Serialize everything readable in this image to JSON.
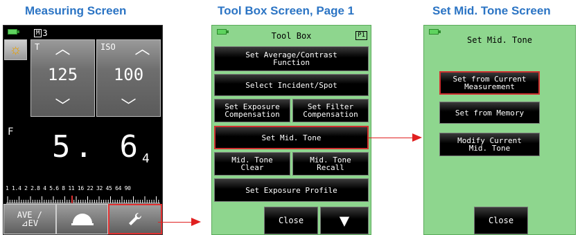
{
  "captions": {
    "measuring": "Measuring Screen",
    "toolbox": "Tool Box Screen, Page 1",
    "midtone": "Set Mid. Tone Screen"
  },
  "measuring": {
    "mode_prefix": "M",
    "mode_number": "3",
    "t_label": "T",
    "t_value": "125",
    "iso_label": "ISO",
    "iso_value": "100",
    "f_label": "F",
    "f_value_main": "5. 6",
    "f_value_sub": "4",
    "scale_numbers": "1  1.4  2  2.8  4  5.6  8  11  16  22  32  45  64  90",
    "ave_line1": "AVE /",
    "ave_line2": "⊿EV",
    "icons": {
      "sun": "sun-icon",
      "dome": "dome-icon",
      "wrench": "wrench-icon"
    }
  },
  "toolbox": {
    "title": "Tool Box",
    "page": "P1",
    "buttons": {
      "avg_contrast_1": "Set Average/Contrast",
      "avg_contrast_2": "Function",
      "incident_spot": "Select Incident/Spot",
      "exp_comp_1": "Set Exposure",
      "exp_comp_2": "Compensation",
      "filter_comp_1": "Set Filter",
      "filter_comp_2": "Compensation",
      "mid_tone": "Set Mid. Tone",
      "mid_clear_1": "Mid. Tone",
      "mid_clear_2": "Clear",
      "mid_recall_1": "Mid. Tone",
      "mid_recall_2": "Recall",
      "exp_profile": "Set Exposure Profile",
      "close": "Close",
      "next": "▼"
    }
  },
  "midtone": {
    "title": "Set Mid. Tone",
    "buttons": {
      "from_current_1": "Set from Current",
      "from_current_2": "Measurement",
      "from_memory": "Set from Memory",
      "modify_1": "Modify Current",
      "modify_2": "Mid. Tone",
      "close": "Close"
    }
  },
  "colors": {
    "caption": "#2b74c4",
    "screen_green": "#8ed68e",
    "highlight": "#d03030",
    "arrow": "#e02020"
  }
}
